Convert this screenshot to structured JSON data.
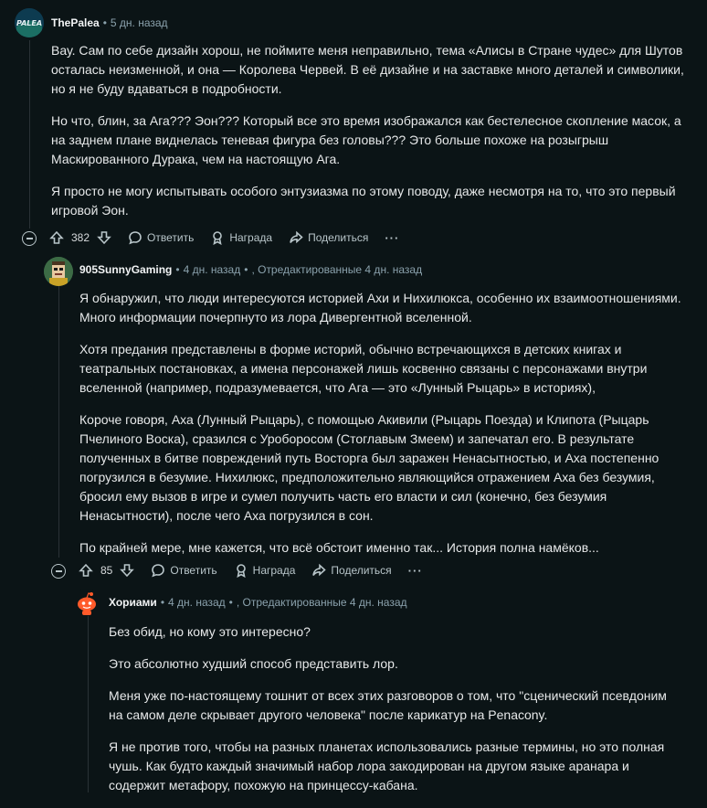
{
  "comments": [
    {
      "author": "ThePalea",
      "time": "5 дн. назад",
      "edited": "",
      "paragraphs": [
        "Вау. Сам по себе дизайн хорош, не поймите меня неправильно, тема «Алисы в Стране чудес» для Шутов осталась неизменной, и она — Королева Червей. В её дизайне и на заставке много деталей и символики, но я не буду вдаваться в подробности.",
        "Но что, блин, за Ага??? Эон??? Который все это время изображался как бестелесное скопление масок, а на заднем плане виднелась теневая фигура без головы??? Это больше похоже на розыгрыш Маскированного Дурака, чем на настоящую Ага.",
        "Я просто не могу испытывать особого энтузиазма по этому поводу, даже несмотря на то, что это первый игровой Эон."
      ],
      "score": "382",
      "reply": "Ответить",
      "award": "Награда",
      "share": "Поделиться",
      "more": "···"
    },
    {
      "author": "905SunnyGaming",
      "time": "4 дн. назад",
      "edited": ", Отредактированные 4 дн. назад",
      "paragraphs": [
        "Я обнаружил, что люди интересуются историей Ахи и Нихилюкса, особенно их взаимоотношениями. Много информации почерпнуто из лора Дивергентной вселенной.",
        "Хотя предания представлены в форме историй, обычно встречающихся в детских книгах и театральных постановках, а имена персонажей лишь косвенно связаны с персонажами внутри вселенной (например, подразумевается, что Ага — это «Лунный Рыцарь» в историях),",
        "Короче говоря, Аха (Лунный Рыцарь), с помощью Акивили (Рыцарь Поезда) и Клипота (Рыцарь Пчелиного Воска), сразился с Уроборосом (Стоглавым Змеем) и запечатал его. В результате полученных в битве повреждений путь Восторга был заражен Ненасытностью, и Аха постепенно погрузился в безумие. Нихилюкс, предположительно являющийся отражением Аха без безумия, бросил ему вызов в игре и сумел получить часть его власти и сил (конечно, без безумия Ненасытности), после чего Аха погрузился в сон.",
        "По крайней мере, мне кажется, что всё обстоит именно так... История полна намёков..."
      ],
      "score": "85",
      "reply": "Ответить",
      "award": "Награда",
      "share": "Поделиться",
      "more": "···"
    },
    {
      "author": "Хориами",
      "time": "4 дн. назад",
      "edited": ", Отредактированные 4 дн. назад",
      "paragraphs": [
        "Без обид, но кому это интересно?",
        "Это абсолютно худший способ представить лор.",
        "Меня уже по-настоящему тошнит от всех этих разговоров о том, что \"сценический псевдоним на самом деле скрывает другого человека\" после карикатур на Penacony.",
        "Я не против того, чтобы на разных планетах использовались разные термины, но это полная чушь. Как будто каждый значимый набор лора закодирован на другом языке аранара и содержит метафору, похожую на принцессу-кабана."
      ]
    }
  ],
  "avatars": {
    "c0_logo_text": "PALEA"
  }
}
